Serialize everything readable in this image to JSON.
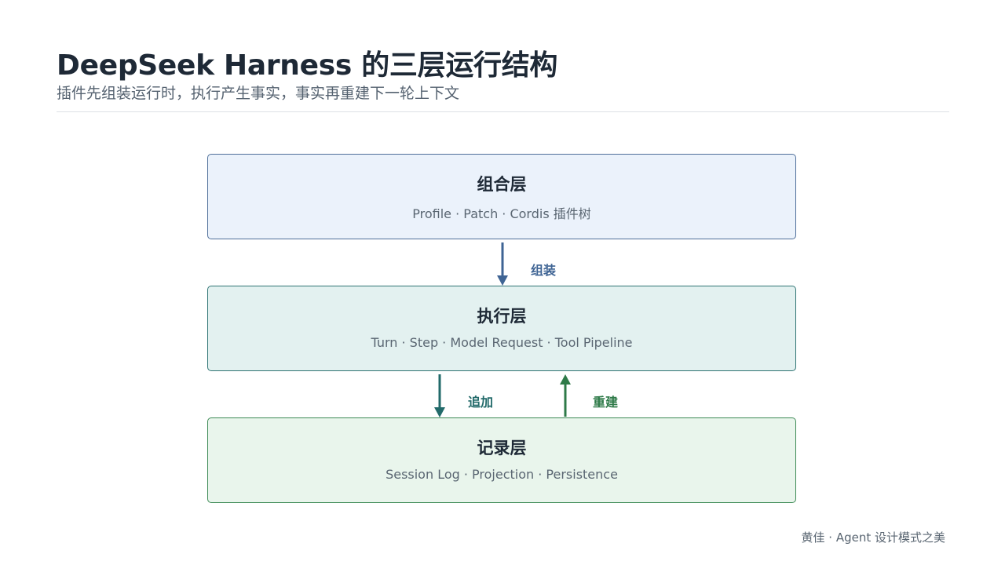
{
  "header": {
    "title": "DeepSeek Harness 的三层运行结构",
    "subtitle": "插件先组装运行时，执行产生事实，事实再重建下一轮上下文"
  },
  "layers": {
    "compose": {
      "title": "组合层",
      "desc": "Profile · Patch · Cordis 插件树"
    },
    "exec": {
      "title": "执行层",
      "desc": "Turn · Step · Model Request · Tool Pipeline"
    },
    "record": {
      "title": "记录层",
      "desc": "Session Log · Projection · Persistence"
    }
  },
  "arrows": {
    "assemble": "组装",
    "append": "追加",
    "rebuild": "重建"
  },
  "colors": {
    "compose_border": "#4f6f9a",
    "exec_border": "#2f7474",
    "record_border": "#3d8a55",
    "assemble_arrow": "#3f6494",
    "append_arrow": "#226a6a",
    "rebuild_arrow": "#2e7a48"
  },
  "footer": {
    "credit": "黄佳 · Agent 设计模式之美"
  }
}
